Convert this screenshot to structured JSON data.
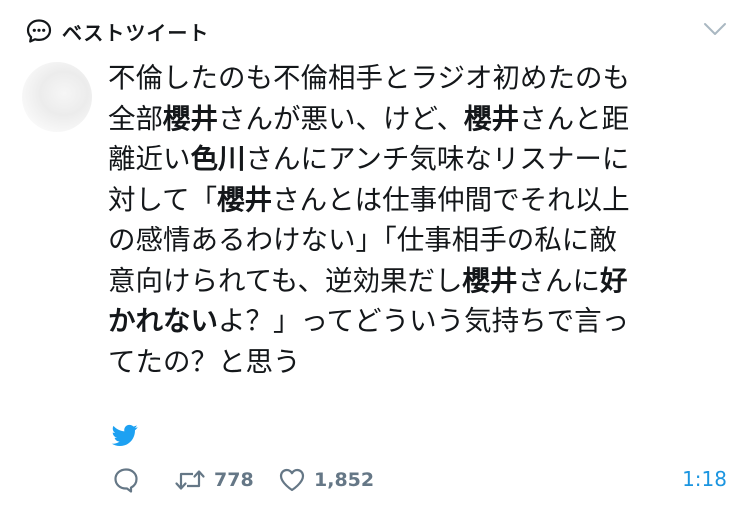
{
  "header": {
    "title": "ベストツイート",
    "icon": "speech-bubble-icon",
    "menu_icon": "chevron-down-icon"
  },
  "tweet": {
    "lines": [
      [
        {
          "t": "不倫したのも不倫相手とラジオ初めたのも"
        }
      ],
      [
        {
          "t": "全部"
        },
        {
          "t": "櫻井",
          "b": true
        },
        {
          "t": "さんが悪い、けど、"
        },
        {
          "t": "櫻井",
          "b": true
        },
        {
          "t": "さんと距"
        }
      ],
      [
        {
          "t": "離近い"
        },
        {
          "t": "色川",
          "b": true
        },
        {
          "t": "さんにアンチ気味なリスナーに"
        }
      ],
      [
        {
          "t": "対して「"
        },
        {
          "t": "櫻井",
          "b": true
        },
        {
          "t": "さんとは仕事仲間でそれ以上"
        }
      ],
      [
        {
          "t": "の感情あるわけない」「仕事相手の私に敵"
        }
      ],
      [
        {
          "t": "意向けられても、逆効果だし"
        },
        {
          "t": "櫻井",
          "b": true
        },
        {
          "t": "さんに"
        },
        {
          "t": "好",
          "b": true
        }
      ],
      [
        {
          "t": "かれない",
          "b": true
        },
        {
          "t": "よ？」ってどういう気持ちで言っ"
        }
      ],
      [
        {
          "t": "てたの？と思う"
        }
      ]
    ],
    "source_icon": "twitter-bird-icon"
  },
  "actions": {
    "reply_icon": "reply-icon",
    "retweet_icon": "retweet-icon",
    "retweet_count": "778",
    "like_icon": "heart-icon",
    "like_count": "1,852",
    "time": "1:18"
  },
  "colors": {
    "text": "#14171a",
    "muted": "#657786",
    "accent": "#1b95e0",
    "bird": "#1da1f2"
  }
}
